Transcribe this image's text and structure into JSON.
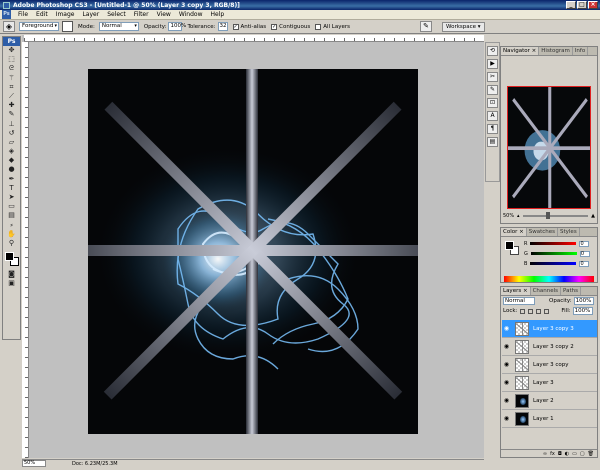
{
  "window": {
    "title": "Adobe Photoshop CS3 - [Untitled-1 @ 50% (Layer 3 copy 3, RGB/8)]",
    "min": "_",
    "max": "□",
    "close": "×"
  },
  "menu": {
    "logo": "Ps",
    "items": [
      "File",
      "Edit",
      "Image",
      "Layer",
      "Select",
      "Filter",
      "View",
      "Window",
      "Help"
    ]
  },
  "options": {
    "fill_source": "Foreground",
    "mode_label": "Mode:",
    "mode_value": "Normal",
    "opacity_label": "Opacity:",
    "opacity_value": "100%",
    "tolerance_label": "Tolerance:",
    "tolerance_value": "32",
    "antialias_label": "Anti-alias",
    "contiguous_label": "Contiguous",
    "all_layers_label": "All Layers",
    "workspace_label": "Workspace ▾"
  },
  "toolbox": {
    "caption": "Ps",
    "icons": [
      "move-icon",
      "marquee-icon",
      "lasso-icon",
      "magic-wand-icon",
      "crop-icon",
      "slice-icon",
      "healing-icon",
      "brush-icon",
      "stamp-icon",
      "history-brush-icon",
      "eraser-icon",
      "bucket-icon",
      "blur-icon",
      "dodge-icon",
      "pen-icon",
      "type-icon",
      "path-select-icon",
      "shape-icon",
      "notes-icon",
      "eyedropper-icon",
      "hand-icon",
      "zoom-icon"
    ]
  },
  "status": {
    "zoom": "50%",
    "doc": "Doc: 6.23M/25.3M"
  },
  "navigator": {
    "tabs": [
      "Navigator ×",
      "Histogram",
      "Info"
    ],
    "zoom": "50%"
  },
  "color": {
    "tabs": [
      "Color ×",
      "Swatches",
      "Styles"
    ],
    "r_label": "R",
    "r_value": "0",
    "g_label": "G",
    "g_value": "0",
    "b_label": "B",
    "b_value": "0",
    "accent_red": "#e02020"
  },
  "layers": {
    "tabs": [
      "Layers ×",
      "Channels",
      "Paths"
    ],
    "blend_mode": "Normal",
    "opacity_label": "Opacity:",
    "opacity_value": "100%",
    "lock_label": "Lock:",
    "fill_label": "Fill:",
    "fill_value": "100%",
    "items": [
      {
        "name": "Layer 3 copy 3",
        "selected": true
      },
      {
        "name": "Layer 3 copy 2",
        "selected": false
      },
      {
        "name": "Layer 3 copy",
        "selected": false
      },
      {
        "name": "Layer 3",
        "selected": false
      },
      {
        "name": "Layer 2",
        "selected": false
      },
      {
        "name": "Layer 1",
        "selected": false
      }
    ],
    "selection_color": "#3399ff"
  }
}
